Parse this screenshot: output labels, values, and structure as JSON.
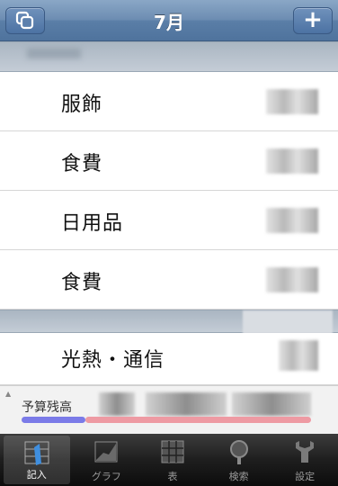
{
  "navbar": {
    "title": "7月",
    "left_button_icon": "copy-icon",
    "right_button_label": "+"
  },
  "rows": [
    {
      "label": "服飾"
    },
    {
      "label": "食費"
    },
    {
      "label": "日用品"
    },
    {
      "label": "食費"
    },
    {
      "label": "光熱・通信"
    }
  ],
  "budget": {
    "label": "予算残高",
    "spent_fraction": 0.22,
    "colors": {
      "spent": "#7b7be8",
      "remaining": "#ee9aa3"
    }
  },
  "tabs": [
    {
      "label": "記入",
      "icon": "pen-icon",
      "active": true
    },
    {
      "label": "グラフ",
      "icon": "graph-icon",
      "active": false
    },
    {
      "label": "表",
      "icon": "table-icon",
      "active": false
    },
    {
      "label": "検索",
      "icon": "search-icon",
      "active": false
    },
    {
      "label": "設定",
      "icon": "wrench-icon",
      "active": false
    }
  ],
  "colors": {
    "navbar": "#5f80a8",
    "section_header": "#b6c0cb",
    "tabbar": "#1e1e1e"
  }
}
